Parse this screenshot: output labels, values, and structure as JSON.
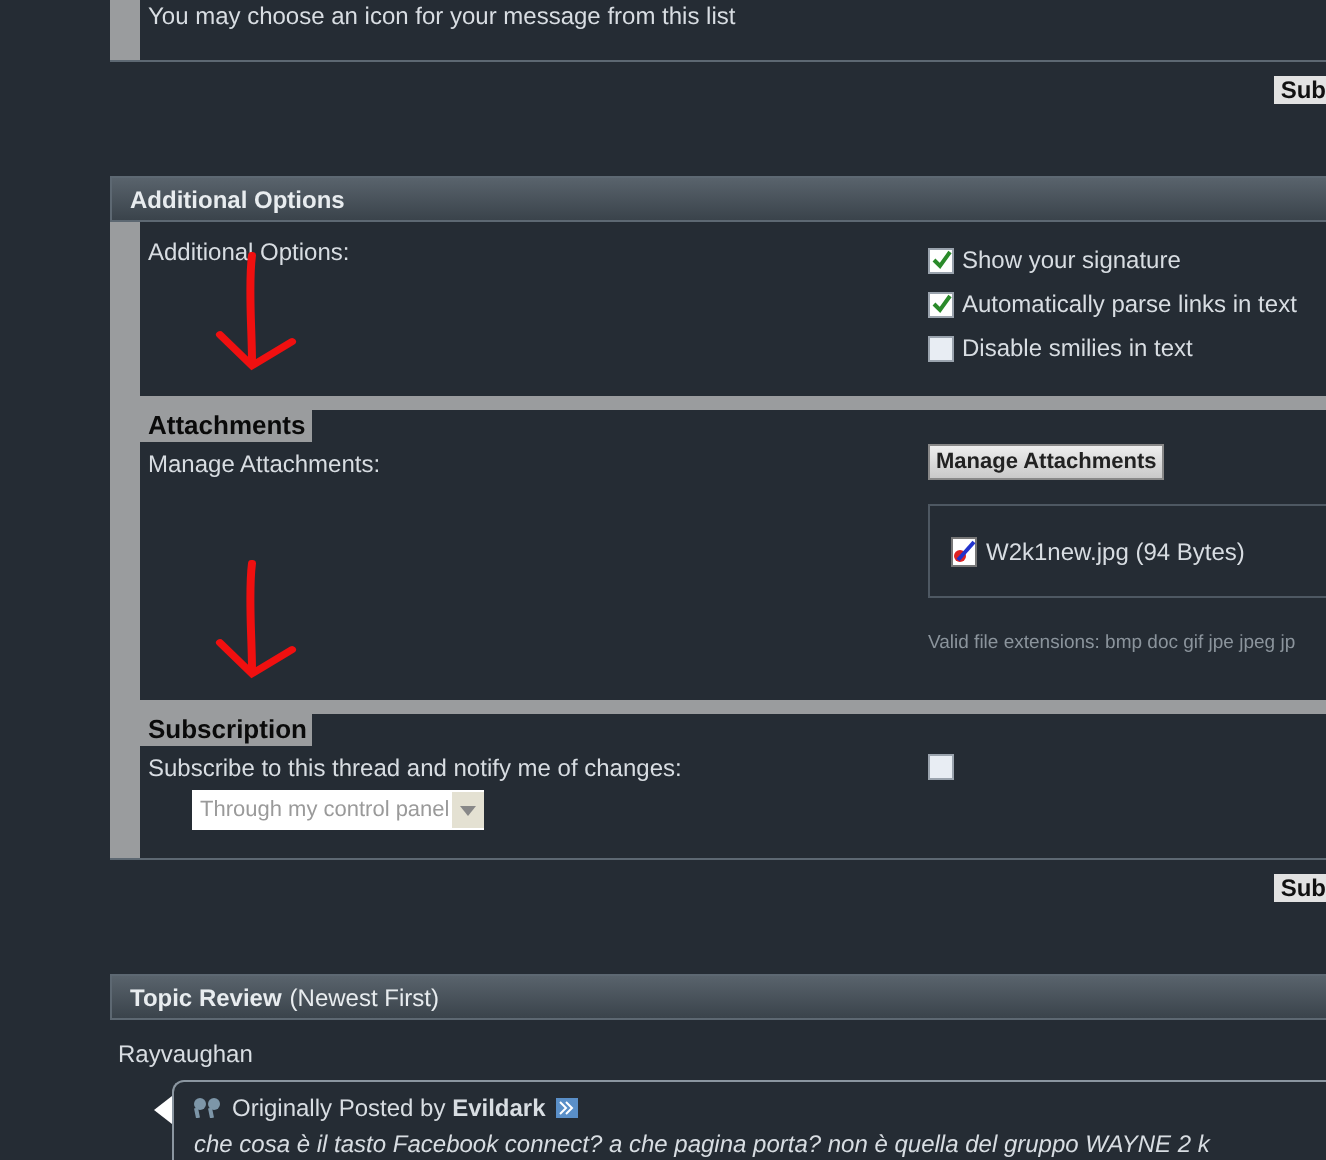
{
  "top_panel": {
    "hint": "You may choose an icon for your message from this list"
  },
  "submit_top": "Sub",
  "additional_options": {
    "title": "Additional Options",
    "label": "Additional Options:",
    "options": [
      {
        "label": "Show your signature",
        "checked": true
      },
      {
        "label": "Automatically parse links in text",
        "checked": true
      },
      {
        "label": "Disable smilies in text",
        "checked": false
      }
    ]
  },
  "attachments": {
    "heading": "Attachments",
    "label": "Manage Attachments:",
    "button": "Manage Attachments",
    "file": "W2k1new.jpg (94 Bytes)",
    "extensions": "Valid file extensions: bmp doc gif jpe jpeg jp"
  },
  "subscription": {
    "heading": "Subscription",
    "label": "Subscribe to this thread and notify me of changes:",
    "subscribed": false,
    "mode": "Through my control panel"
  },
  "submit_bottom": "Sub",
  "topic_review": {
    "title": "Topic Review",
    "subtitle": "(Newest First)",
    "author": "Rayvaughan",
    "quote": {
      "prefix": "Originally Posted by",
      "author": "Evildark",
      "text": "che cosa è il tasto Facebook connect? a che pagina porta? non è quella del gruppo WAYNE 2 k"
    }
  }
}
